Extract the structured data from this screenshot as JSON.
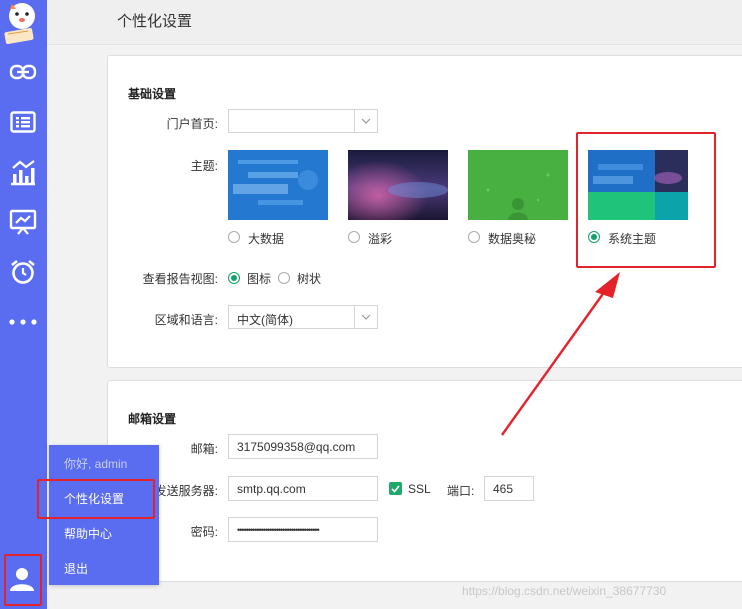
{
  "page": {
    "title": "个性化设置"
  },
  "sidebar": {
    "icons": [
      "link-icon",
      "list-icon",
      "chart-icon",
      "dashboard-icon",
      "alarm-icon",
      "more-icon",
      "user-icon"
    ]
  },
  "basic": {
    "section_title": "基础设置",
    "portal_label": "门户首页:",
    "portal_value": "",
    "theme_label": "主题:",
    "themes": [
      {
        "label": "大数据",
        "selected": false
      },
      {
        "label": "溢彩",
        "selected": false
      },
      {
        "label": "数据奥秘",
        "selected": false
      },
      {
        "label": "系统主题",
        "selected": true
      }
    ],
    "report_view_label": "查看报告视图:",
    "report_view_options": [
      {
        "label": "图标",
        "selected": true
      },
      {
        "label": "树状",
        "selected": false
      }
    ],
    "region_label": "区域和语言:",
    "region_value": "中文(简体)"
  },
  "mail": {
    "section_title": "邮箱设置",
    "email_label": "邮箱:",
    "email_value": "3175099358@qq.com",
    "smtp_label": "发送服务器:",
    "smtp_value": "smtp.qq.com",
    "ssl_label": "SSL",
    "ssl_checked": true,
    "port_label": "端口:",
    "port_value": "465",
    "password_label": "密码:",
    "password_value": "••••••••••••••••••••••••••••••••••••••"
  },
  "user_menu": {
    "greeting": "你好, admin",
    "items": [
      "个性化设置",
      "帮助中心",
      "退出"
    ]
  },
  "watermark": "https://blog.csdn.net/weixin_38677730",
  "colors": {
    "sidebar": "#5a6cf0",
    "accent_green": "#11a36a",
    "highlight_red": "#e4222a"
  }
}
